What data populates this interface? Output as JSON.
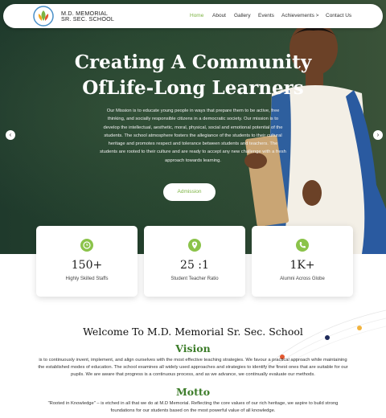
{
  "nav": {
    "brand_line1": "M.D. MEMORIAL",
    "brand_line2": "SR. SEC. SCHOOL",
    "items": [
      "Home",
      "About",
      "Gallery",
      "Events",
      "Achievements >",
      "Contact Us"
    ],
    "active": "Home"
  },
  "hero": {
    "title_line1": "Creating A Community",
    "title_line2": "OfLife-Long Learners",
    "text": "Our Mission is to educate young people in ways that prepare them to be active, free thinking, and socially responsible citizens in a democratic society. Our mission is to develop the intellectual, aesthetic, moral, physical, social and emotional potential of the students. The school atmosphere fosters the allegiance of the students to their cultural heritage and promotes respect and tolerance between students and teachers. The students are rooted to their culture and are ready to accept any new challenge with a fresh approach towards learning.",
    "button": "Admission",
    "prev": "‹",
    "next": "›"
  },
  "stats": [
    {
      "icon": "clock-icon",
      "value": "150+",
      "label": "Highly Skilled Staffs"
    },
    {
      "icon": "location-pin-icon",
      "value": "25 :1",
      "label": "Student Teacher Ratio"
    },
    {
      "icon": "phone-icon",
      "value": "1K+",
      "label": "Alumni Across Globe"
    }
  ],
  "welcome": {
    "title": "Welcome To M.D. Memorial Sr. Sec. School",
    "vision_title": "Vision",
    "vision_text": "is to continuously invent, implement, and align ourselves with the most effective teaching strategies. We favour a practical approach while maintaining the established modes of education. The school examines all widely used approaches and strategies to identify the finest ones that are suitable for our pupils. We are aware that progress is a continuous process, and as we advance, we continually evaluate our methods.",
    "motto_title": "Motto",
    "motto_text": "\"Rooted in Knowledge\" – is etched in all that we do at M.D Memorial. Reflecting the core values of our rich heritage, we aspire to build strong foundations for our students based on the most powerful value of all knowledge."
  },
  "colors": {
    "accent": "#7cb342",
    "icon_bg": "#8bc34a",
    "heading_green": "#3d7d2a",
    "hero_bg": "#27452f"
  }
}
